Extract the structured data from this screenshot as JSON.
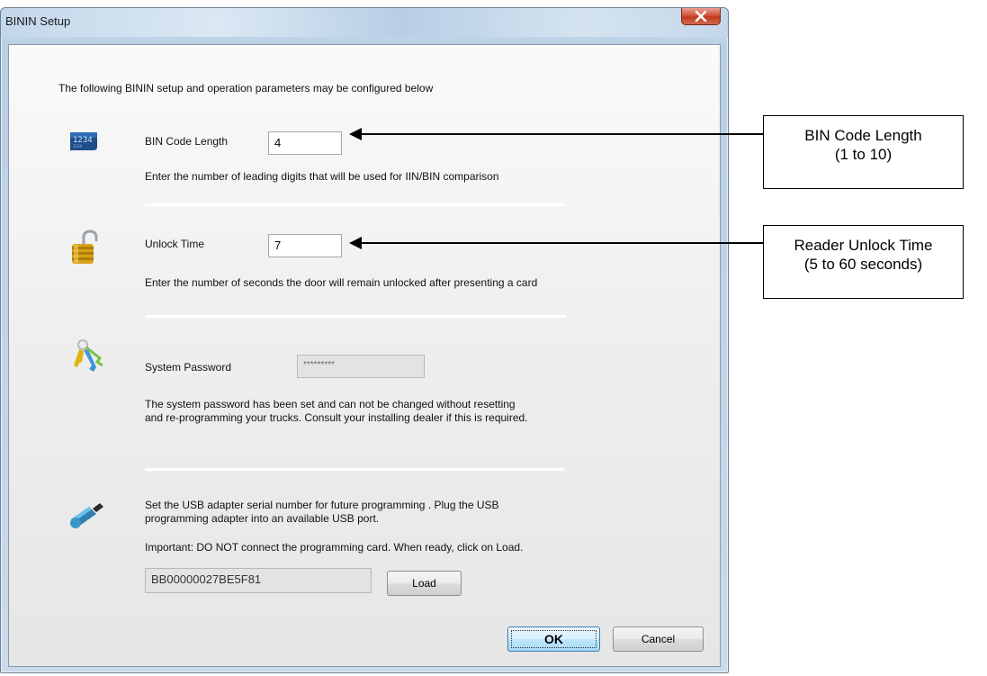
{
  "window": {
    "title": "BININ Setup"
  },
  "intro": "The following BININ setup and operation parameters may be configured below",
  "bin_code": {
    "label": "BIN Code Length",
    "value": "4",
    "description": "Enter the number of leading digits that will be used for IIN/BIN comparison",
    "icon": "numbers-card-icon"
  },
  "unlock": {
    "label": "Unlock Time",
    "value": "7",
    "description": "Enter the number of seconds the door will remain unlocked after presenting a card",
    "icon": "padlock-icon"
  },
  "password": {
    "label": "System Password",
    "value": "*********",
    "description_line1": "The system password has been set and can not be changed without resetting",
    "description_line2": "and re-programming your trucks. Consult your installing dealer if this is required.",
    "icon": "keys-icon"
  },
  "usb": {
    "instruction_line1": "Set the USB adapter serial number for future programming . Plug the USB",
    "instruction_line2": "programming adapter into an available USB port.",
    "important": "Important: DO NOT connect the programming card. When ready, click on Load.",
    "serial": "BB00000027BE5F81",
    "load_label": "Load",
    "icon": "usb-adapter-icon"
  },
  "buttons": {
    "ok": "OK",
    "cancel": "Cancel"
  },
  "callouts": {
    "bin_line1": "BIN Code Length",
    "bin_line2": "(1 to 10)",
    "unlock_line1": "Reader Unlock Time",
    "unlock_line2": "(5 to 60 seconds)"
  }
}
